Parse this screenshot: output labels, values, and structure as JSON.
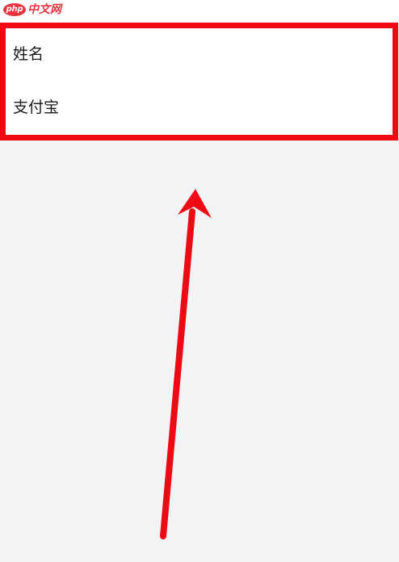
{
  "watermark": {
    "logo_oval": "php",
    "logo_text": "中文网"
  },
  "fields": {
    "items": [
      {
        "label": "姓名"
      },
      {
        "label": "支付宝"
      }
    ]
  },
  "annotation": {
    "highlight_color": "#ee0a14",
    "arrow_color": "#ee0a14"
  }
}
